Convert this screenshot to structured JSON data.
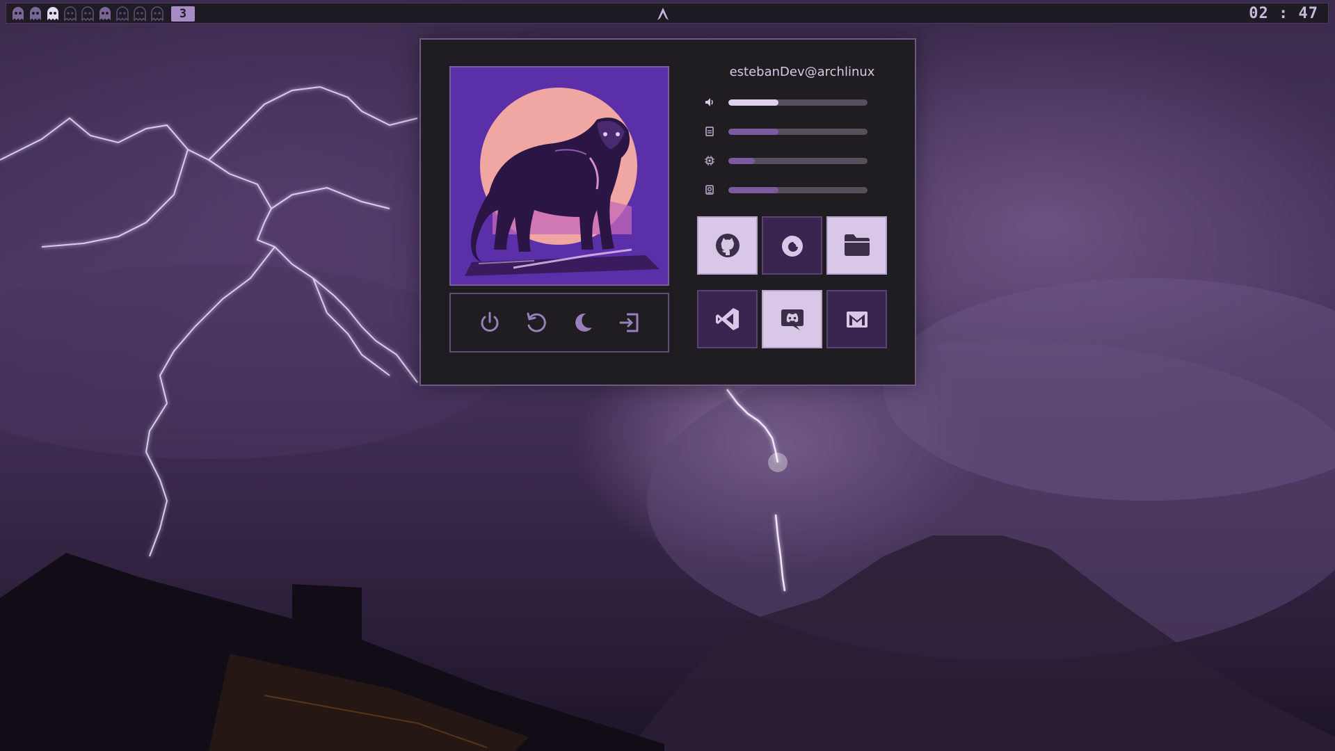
{
  "desktop": {
    "wallpaper": "purple lightning storm over mountains and rooftop",
    "colors": {
      "accent": "#a68bc4",
      "panel_bg": "#1f1d22",
      "panel_border": "#6e5a85",
      "tile_light": "#d9c7e8",
      "tile_dark": "#3a2550"
    }
  },
  "topbar": {
    "workspaces": {
      "count": 9,
      "icon": "ghost-icon",
      "active_index": 3,
      "current_label": "3"
    },
    "center_icon": "arch-linux-icon",
    "clock": "02 : 47"
  },
  "dashboard": {
    "user": "estebanDev@archlinux",
    "avatar": "pixel-art black panther in front of pink moon",
    "stats": [
      {
        "name": "volume",
        "icon": "volume-icon",
        "level": 0.36
      },
      {
        "name": "memory",
        "icon": "memory-icon",
        "level": 0.36
      },
      {
        "name": "cpu",
        "icon": "cpu-icon",
        "level": 0.19
      },
      {
        "name": "disk",
        "icon": "disk-icon",
        "level": 0.36
      }
    ],
    "power_actions": [
      {
        "name": "power-off",
        "icon": "power-icon"
      },
      {
        "name": "restart",
        "icon": "restart-icon"
      },
      {
        "name": "sleep",
        "icon": "moon-icon"
      },
      {
        "name": "logout",
        "icon": "logout-icon"
      }
    ],
    "apps": [
      {
        "name": "github",
        "icon": "github-icon",
        "style": "light"
      },
      {
        "name": "firefox",
        "icon": "firefox-icon",
        "style": "dark"
      },
      {
        "name": "files",
        "icon": "folder-icon",
        "style": "light"
      },
      {
        "name": "vscode",
        "icon": "vscode-icon",
        "style": "dark"
      },
      {
        "name": "discord",
        "icon": "discord-icon",
        "style": "light"
      },
      {
        "name": "gmail",
        "icon": "mail-icon",
        "style": "dark"
      }
    ]
  }
}
